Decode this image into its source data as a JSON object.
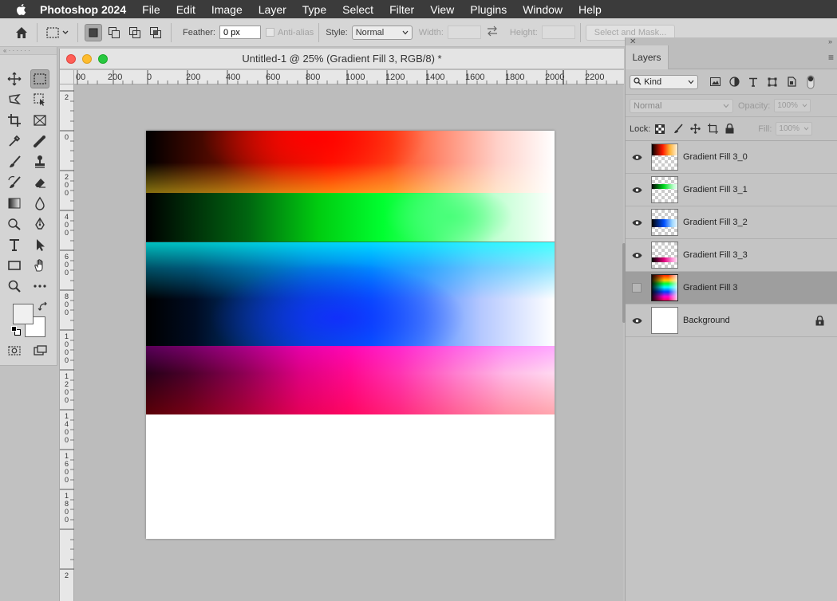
{
  "menubar": {
    "app_name": "Photoshop 2024",
    "items": [
      "File",
      "Edit",
      "Image",
      "Layer",
      "Type",
      "Select",
      "Filter",
      "View",
      "Plugins",
      "Window",
      "Help"
    ]
  },
  "options": {
    "feather_label": "Feather:",
    "feather_value": "0 px",
    "antialias_label": "Anti-alias",
    "style_label": "Style:",
    "style_value": "Normal",
    "width_label": "Width:",
    "height_label": "Height:",
    "select_mask_label": "Select and Mask..."
  },
  "document": {
    "title": "Untitled-1 @ 25% (Gradient Fill 3, RGB/8) *",
    "ruler_h": [
      "00",
      "200",
      "0",
      "200",
      "400",
      "600",
      "800",
      "1000",
      "1200",
      "1400",
      "1600",
      "1800",
      "2000",
      "2200"
    ],
    "ruler_v": [
      "2",
      "0",
      "2 0 0",
      "4 0 0",
      "6 0 0",
      "8 0 0",
      "1 0 0 0",
      "1 2 0 0",
      "1 4 0 0",
      "1 6 0 0",
      "1 8 0 0",
      "2"
    ]
  },
  "layers_panel": {
    "tab_label": "Layers",
    "kind_label": "Kind",
    "blend_mode": "Normal",
    "opacity_label": "Opacity:",
    "opacity_value": "100%",
    "lock_label": "Lock:",
    "fill_label": "Fill:",
    "fill_value": "100%",
    "layers": [
      {
        "name": "Gradient Fill 3_0",
        "visible": true
      },
      {
        "name": "Gradient Fill 3_1",
        "visible": true
      },
      {
        "name": "Gradient Fill 3_2",
        "visible": true
      },
      {
        "name": "Gradient Fill 3_3",
        "visible": true
      },
      {
        "name": "Gradient Fill 3",
        "visible": false,
        "selected": true
      },
      {
        "name": "Background",
        "visible": true,
        "locked": true
      }
    ]
  },
  "colors": {
    "foreground": "#f0f0f0",
    "background": "#ffffff",
    "selected_layer": "#9e9e9e"
  }
}
